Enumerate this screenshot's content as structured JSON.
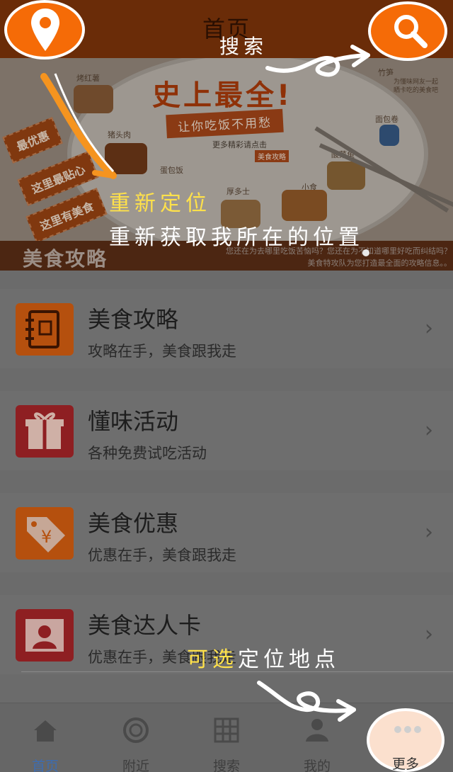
{
  "header": {
    "title": "首页"
  },
  "banner": {
    "headline": "史上最全!",
    "ribbon": "让你吃饭不用愁",
    "more_text": "更多精彩请点击",
    "button": "美食攻略",
    "tags": [
      "最优惠",
      "这里最贴心",
      "这里有美食"
    ],
    "foods": [
      "烤红薯",
      "猪头肉",
      "蛋包饭",
      "厚多士",
      "小食",
      "酸菜鱼",
      "竹笋",
      "面包卷"
    ],
    "food_note": "为懂味网友一起晒卡吃的美食吧",
    "brand": "美食攻略",
    "desc_line1": "您还在为去哪里吃饭苦恼吗？您还在为不知道哪里好吃而纠结吗？",
    "desc_line2": "美食特攻队为您打造最全面的攻略信息。。",
    "colors": {
      "brand_orange": "#f56b07",
      "header_brown": "#6a2c08"
    }
  },
  "list": {
    "items": [
      {
        "title": "美食攻略",
        "subtitle": "攻略在手，美食跟我走",
        "icon": "notebook-icon",
        "color": "#b5500e"
      },
      {
        "title": "懂味活动",
        "subtitle": "各种免费试吃活动",
        "icon": "gift-icon",
        "color": "#8e1f22"
      },
      {
        "title": "美食优惠",
        "subtitle": "优惠在手，美食跟我走",
        "icon": "price-tag-icon",
        "color": "#b5500e"
      },
      {
        "title": "美食达人卡",
        "subtitle": "优惠在手，美食跟我走",
        "icon": "user-card-icon",
        "color": "#8e1f22"
      }
    ],
    "chevron": "›"
  },
  "tabbar": {
    "tabs": [
      {
        "label": "首页",
        "icon": "home-icon",
        "active": true
      },
      {
        "label": "附近",
        "icon": "target-icon",
        "active": false
      },
      {
        "label": "搜索",
        "icon": "grid-icon",
        "active": false
      },
      {
        "label": "我的",
        "icon": "user-icon",
        "active": false
      },
      {
        "label": "更多",
        "icon": "more-icon",
        "active": false
      }
    ],
    "active_color": "#3d6cb0"
  },
  "annotations": {
    "search": "搜索",
    "relocate_title": "重新定位",
    "relocate_desc": "重新获取我所在的位置",
    "optional_highlight": "可选",
    "optional_rest": "定位地点"
  }
}
